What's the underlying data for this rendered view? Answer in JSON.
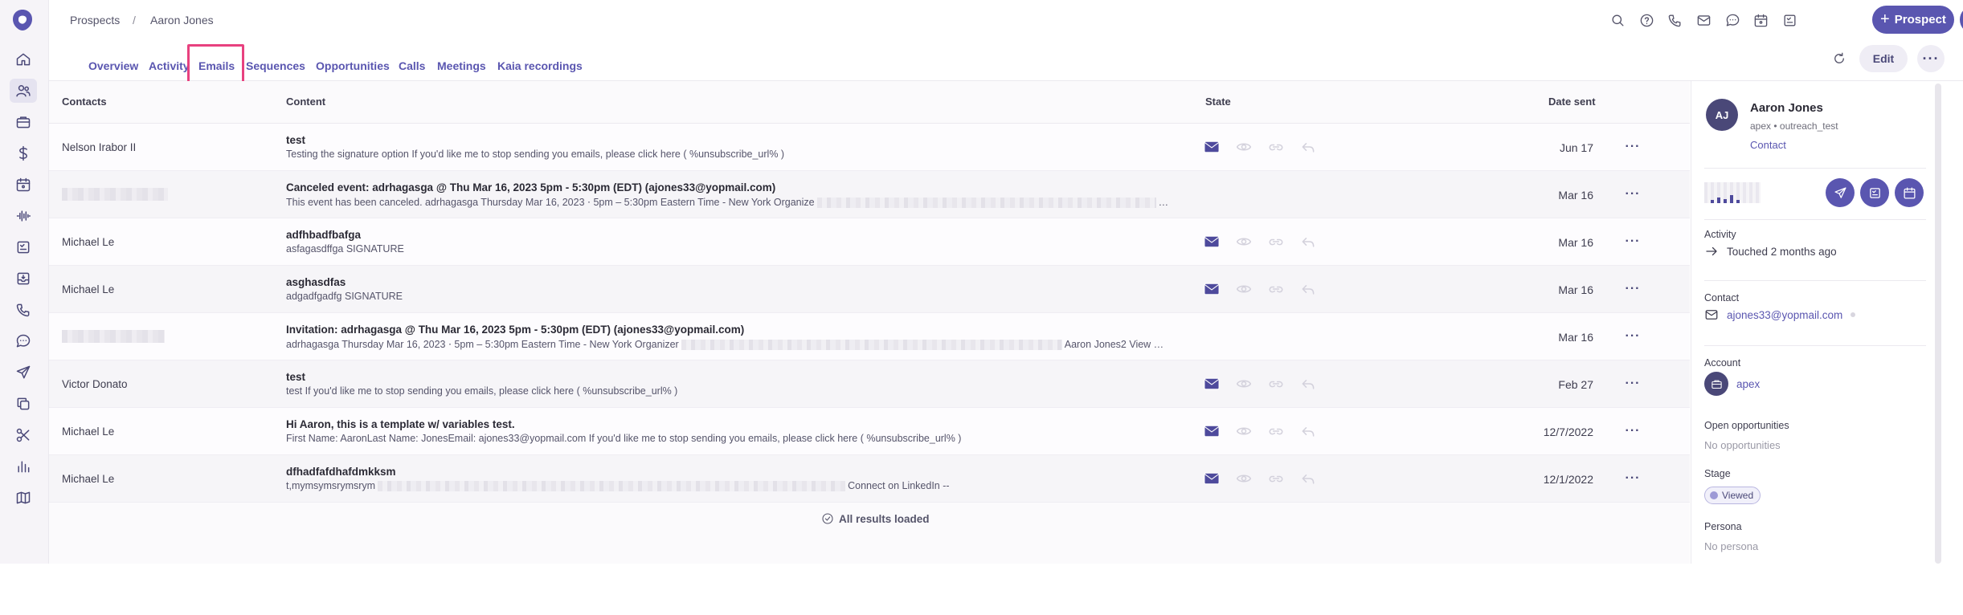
{
  "nav": {
    "items": [
      "home-icon",
      "people-icon",
      "briefcase-icon",
      "dollar-icon",
      "calendar-icon",
      "waveform-icon",
      "task-icon",
      "inbox-icon",
      "phone-icon",
      "chat-icon",
      "send-icon",
      "copy-icon",
      "scissors-icon",
      "bar-chart-icon",
      "map-icon"
    ],
    "active": "people-icon"
  },
  "breadcrumb": {
    "parent": "Prospects",
    "separator": "/",
    "current": "Aaron Jones"
  },
  "topbar": {
    "prospect_button": "Prospect",
    "icons": [
      "search-icon",
      "help-icon",
      "phone-icon",
      "mail-icon",
      "chat-icon",
      "calendar-icon",
      "task-icon",
      "bolt-icon"
    ]
  },
  "tabs": [
    {
      "label": "Overview"
    },
    {
      "label": "Activity"
    },
    {
      "label": "Emails",
      "active": true
    },
    {
      "label": "Sequences"
    },
    {
      "label": "Opportunities"
    },
    {
      "label": "Calls"
    },
    {
      "label": "Meetings"
    },
    {
      "label": "Kaia recordings"
    }
  ],
  "actions": {
    "edit": "Edit"
  },
  "table": {
    "headers": {
      "contacts": "Contacts",
      "content": "Content",
      "state": "State",
      "date_sent": "Date sent"
    },
    "rows": [
      {
        "contact": "Nelson Irabor II",
        "subject": "test",
        "preview": "Testing the signature option If you'd like me to stop sending you emails, please click here ( %unsubscribe_url% )",
        "date": "Jun 17",
        "has_states": true
      },
      {
        "contact": "",
        "subject": "Canceled event: adrhagasga @ Thu Mar 16, 2023 5pm - 5:30pm (EDT) (ajones33@yopmail.com)",
        "preview": "This event has been canceled. adrhagasga Thursday Mar 16, 2023 ⋅ 5pm – 5:30pm Eastern Time - New York Organize",
        "preview_tail": "…",
        "date": "Mar 16",
        "has_states": false
      },
      {
        "contact": "Michael Le",
        "subject": "adfhbadfbafga",
        "preview": "asfagasdffga SIGNATURE",
        "date": "Mar 16",
        "has_states": true
      },
      {
        "contact": "Michael Le",
        "subject": "asghasdfas",
        "preview": "adgadfgadfg SIGNATURE",
        "date": "Mar 16",
        "has_states": true
      },
      {
        "contact": "",
        "subject": "Invitation: adrhagasga @ Thu Mar 16, 2023 5pm - 5:30pm (EDT) (ajones33@yopmail.com)",
        "preview": "adrhagasga Thursday Mar 16, 2023 ⋅ 5pm – 5:30pm Eastern Time - New York Organizer",
        "preview_tail": "Aaron Jones2 View …",
        "date": "Mar 16",
        "has_states": false
      },
      {
        "contact": "Victor Donato",
        "subject": "test",
        "preview": "test If you'd like me to stop sending you emails, please click here ( %unsubscribe_url% )",
        "date": "Feb 27",
        "has_states": true
      },
      {
        "contact": "Michael Le",
        "subject": "Hi Aaron, this is a template w/ variables test.",
        "preview": "First Name: AaronLast Name: JonesEmail: ajones33@yopmail.com If you'd like me to stop sending you emails, please click here ( %unsubscribe_url% )",
        "date": "12/7/2022",
        "has_states": true
      },
      {
        "contact": "Michael Le",
        "subject": "dfhadfafdhafdmkksm",
        "preview": "t,mymsymsrymsrym",
        "preview_tail": "Connect on LinkedIn --",
        "date": "12/1/2022",
        "has_states": true
      }
    ],
    "footer": "All results loaded"
  },
  "panel": {
    "initials": "AJ",
    "name": "Aaron Jones",
    "subtitle": "apex • outreach_test",
    "type_link": "Contact",
    "activity_title": "Activity",
    "activity_value": "Touched 2 months ago",
    "contact_title": "Contact",
    "email": "ajones33@yopmail.com",
    "account_title": "Account",
    "account_name": "apex",
    "opps_title": "Open opportunities",
    "opps_value": "No opportunities",
    "stage_title": "Stage",
    "stage_value": "Viewed",
    "persona_title": "Persona",
    "persona_value": "No persona"
  },
  "colors": {
    "accent": "#5a56b0",
    "highlight": "#e8417f"
  }
}
